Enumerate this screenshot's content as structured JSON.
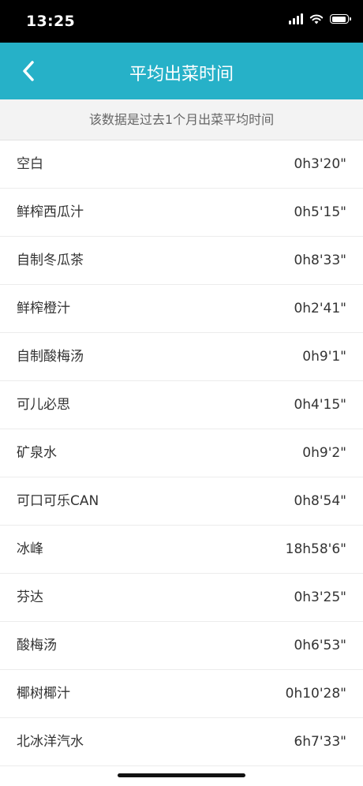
{
  "status_bar": {
    "time": "13:25",
    "icons": [
      "cellular-signal-icon",
      "wifi-icon",
      "battery-icon"
    ]
  },
  "header": {
    "title": "平均出菜时间",
    "back_icon": "chevron-left-icon",
    "background_color": "#26b1c8"
  },
  "notice": {
    "text": "该数据是过去1个月出菜平均时间"
  },
  "items": [
    {
      "name": "空白",
      "time": "0h3'20\""
    },
    {
      "name": "鲜榨西瓜汁",
      "time": "0h5'15\""
    },
    {
      "name": "自制冬瓜茶",
      "time": "0h8'33\""
    },
    {
      "name": "鲜榨橙汁",
      "time": "0h2'41\""
    },
    {
      "name": "自制酸梅汤",
      "time": "0h9'1\""
    },
    {
      "name": "可儿必思",
      "time": "0h4'15\""
    },
    {
      "name": "矿泉水",
      "time": "0h9'2\""
    },
    {
      "name": "可口可乐CAN",
      "time": "0h8'54\""
    },
    {
      "name": "冰峰",
      "time": "18h58'6\""
    },
    {
      "name": "芬达",
      "time": "0h3'25\""
    },
    {
      "name": "酸梅汤",
      "time": "0h6'53\""
    },
    {
      "name": "椰树椰汁",
      "time": "0h10'28\""
    },
    {
      "name": "北冰洋汽水",
      "time": "6h7'33\""
    }
  ]
}
